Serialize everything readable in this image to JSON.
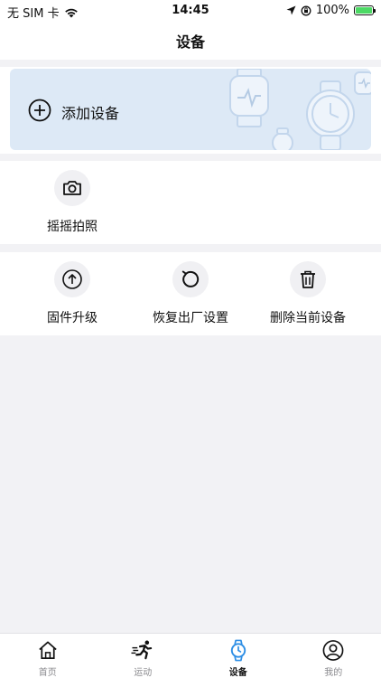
{
  "status_bar": {
    "carrier": "无 SIM 卡",
    "time": "14:45",
    "battery": "100%"
  },
  "nav": {
    "title": "设备"
  },
  "add_device": {
    "label": "添加设备"
  },
  "shake_photo": {
    "label": "摇摇拍照",
    "icon": "camera-icon"
  },
  "actions": [
    {
      "label": "固件升级",
      "icon": "arrow-up-circle-icon"
    },
    {
      "label": "恢复出厂设置",
      "icon": "reset-icon"
    },
    {
      "label": "删除当前设备",
      "icon": "trash-icon"
    }
  ],
  "tabs": [
    {
      "label": "首页",
      "icon": "home-icon",
      "active": false
    },
    {
      "label": "运动",
      "icon": "running-icon",
      "active": false
    },
    {
      "label": "设备",
      "icon": "watch-icon",
      "active": true
    },
    {
      "label": "我的",
      "icon": "user-icon",
      "active": false
    }
  ],
  "colors": {
    "accent": "#2f8fe5",
    "card_bg": "#dde9f6",
    "page_bg": "#f2f2f5"
  }
}
